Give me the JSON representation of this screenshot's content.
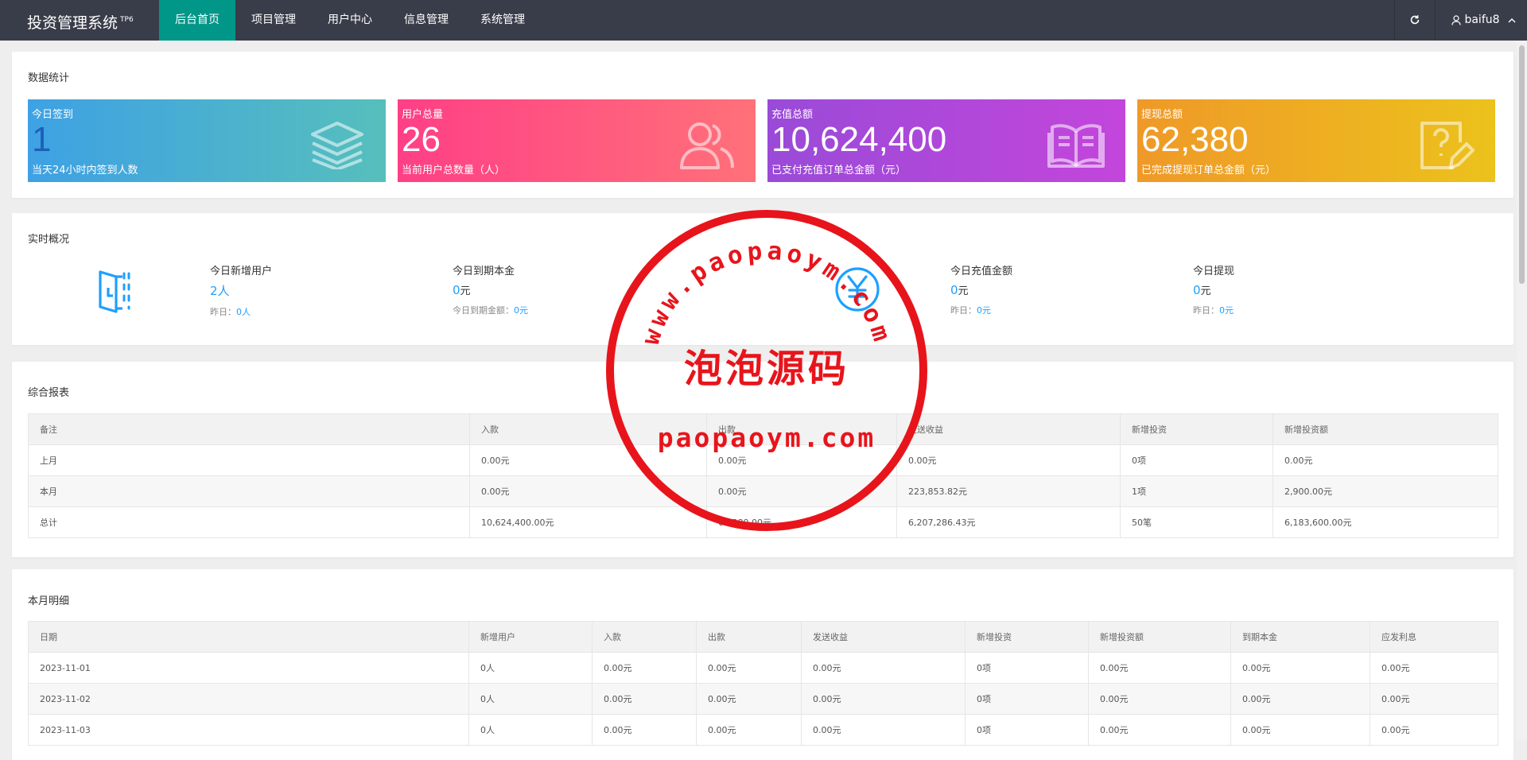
{
  "header": {
    "logo": "投资管理系统",
    "logo_sup": "TP6",
    "nav": [
      "后台首页",
      "项目管理",
      "用户中心",
      "信息管理",
      "系统管理"
    ],
    "username": "baifu8"
  },
  "stats": {
    "title": "数据统计",
    "cards": [
      {
        "label": "今日签到",
        "value": "1",
        "desc": "当天24小时内签到人数",
        "icon": "layers-icon"
      },
      {
        "label": "用户总量",
        "value": "26",
        "desc": "当前用户总数量（人）",
        "icon": "users-icon"
      },
      {
        "label": "充值总额",
        "value": "10,624,400",
        "desc": "已支付充值订单总金额（元）",
        "icon": "book-icon"
      },
      {
        "label": "提现总额",
        "value": "62,380",
        "desc": "已完成提现订单总金额（元）",
        "icon": "edit-question-icon"
      }
    ]
  },
  "realtime": {
    "title": "实时概况",
    "items": [
      {
        "label": "今日新增用户",
        "value": "2",
        "unit": "人",
        "sub_label": "昨日：",
        "sub_value": "0人"
      },
      {
        "label": "今日到期本金",
        "value": "0",
        "unit": "元",
        "sub_label": "今日到期金额：",
        "sub_value": "0元"
      },
      {
        "label": "今日充值金额",
        "value": "0",
        "unit": "元",
        "sub_label": "昨日：",
        "sub_value": "0元"
      },
      {
        "label": "今日提现",
        "value": "0",
        "unit": "元",
        "sub_label": "昨日：",
        "sub_value": "0元"
      }
    ]
  },
  "report": {
    "title": "综合报表",
    "headers": [
      "备注",
      "入款",
      "出款",
      "发送收益",
      "新增投资",
      "新增投资额"
    ],
    "rows": [
      [
        "上月",
        "0.00元",
        "0.00元",
        "0.00元",
        "0项",
        "0.00元"
      ],
      [
        "本月",
        "0.00元",
        "0.00元",
        "223,853.82元",
        "1项",
        "2,900.00元"
      ],
      [
        "总计",
        "10,624,400.00元",
        "62,380.00元",
        "6,207,286.43元",
        "50笔",
        "6,183,600.00元"
      ]
    ]
  },
  "monthly": {
    "title": "本月明细",
    "headers": [
      "日期",
      "新增用户",
      "入款",
      "出款",
      "发送收益",
      "新增投资",
      "新增投资额",
      "到期本金",
      "应发利息"
    ],
    "rows": [
      [
        "2023-11-01",
        "0人",
        "0.00元",
        "0.00元",
        "0.00元",
        "0项",
        "0.00元",
        "0.00元",
        "0.00元"
      ],
      [
        "2023-11-02",
        "0人",
        "0.00元",
        "0.00元",
        "0.00元",
        "0项",
        "0.00元",
        "0.00元",
        "0.00元"
      ],
      [
        "2023-11-03",
        "0人",
        "0.00元",
        "0.00元",
        "0.00元",
        "0项",
        "0.00元",
        "0.00元",
        "0.00元"
      ]
    ]
  },
  "watermark": {
    "url_arc": "www.paopaoym.com",
    "center": "泡泡源码",
    "bottom": "paopaoym.com",
    "color": "#e8141b"
  }
}
